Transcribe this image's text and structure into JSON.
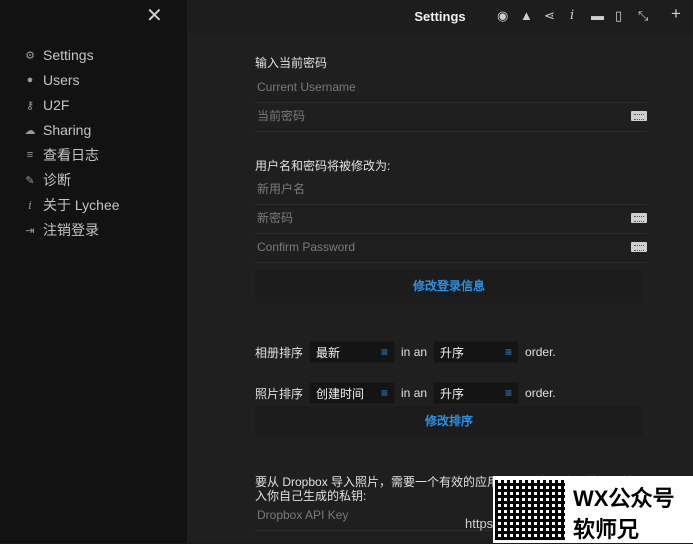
{
  "sidebar": {
    "items": [
      {
        "label": "Settings",
        "icon": "gear-icon"
      },
      {
        "label": "Users",
        "icon": "user-icon"
      },
      {
        "label": "U2F",
        "icon": "key-icon"
      },
      {
        "label": "Sharing",
        "icon": "cloud-icon"
      },
      {
        "label": "查看日志",
        "icon": "list-icon"
      },
      {
        "label": "诊断",
        "icon": "wrench-icon"
      },
      {
        "label": "关于 Lychee",
        "icon": "info-icon"
      },
      {
        "label": "注销登录",
        "icon": "sign-out-icon"
      }
    ]
  },
  "header": {
    "title": "Settings"
  },
  "login": {
    "section_title": "输入当前密码",
    "current_username_placeholder": "Current Username",
    "current_password_placeholder": "当前密码",
    "change_title": "用户名和密码将被修改为:",
    "new_username_placeholder": "新用户名",
    "new_password_placeholder": "新密码",
    "confirm_password_placeholder": "Confirm Password",
    "submit_label": "修改登录信息"
  },
  "sorting": {
    "album_label": "相册排序",
    "album_value": "最新",
    "in_an": "in an",
    "album_order": "升序",
    "order_label": "order.",
    "photo_label": "照片排序",
    "photo_value": "创建时间",
    "photo_order": "升序",
    "submit_label": "修改排序"
  },
  "dropbox": {
    "description": "要从 Dropbox 导入照片，需要一个有效的应用秘钥。请到 官网获取，填入你自己生成的私钥:",
    "key_placeholder": "Dropbox API Key",
    "partial_link": "https"
  },
  "watermark": {
    "line1": "WX公众号",
    "line2": "软师兄"
  }
}
